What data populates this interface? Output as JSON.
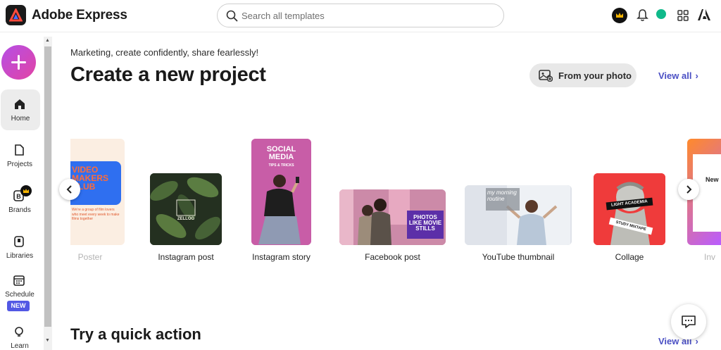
{
  "app": {
    "title": "Adobe Express"
  },
  "search": {
    "placeholder": "Search all templates"
  },
  "sidebar": {
    "items": [
      {
        "label": "Home",
        "icon": "home-icon",
        "active": true
      },
      {
        "label": "Projects",
        "icon": "projects-icon"
      },
      {
        "label": "Brands",
        "icon": "brands-icon"
      },
      {
        "label": "Libraries",
        "icon": "libraries-icon"
      },
      {
        "label": "Schedule",
        "icon": "schedule-icon",
        "badge": "NEW"
      },
      {
        "label": "Learn",
        "icon": "learn-icon"
      }
    ]
  },
  "main": {
    "tagline": "Marketing, create confidently, share fearlessly!",
    "heading": "Create a new project",
    "photo_button": "From your photo",
    "view_all": "View all",
    "cards": [
      {
        "label": "Poster"
      },
      {
        "label": "Instagram post"
      },
      {
        "label": "Instagram story"
      },
      {
        "label": "Facebook post"
      },
      {
        "label": "YouTube thumbnail"
      },
      {
        "label": "Collage"
      },
      {
        "label": "Inv"
      }
    ],
    "card_art": {
      "poster_title": "VIDEO MAKERS CLUB",
      "poster_body": "We're a group of film lovers who meet every week to make films together",
      "insta_post_word": "ZELLOG",
      "story_title": "SOCIAL MEDIA",
      "story_sub": "TIPS & TRICKS",
      "facebook_text": "PHOTOS LIKE MOVIE STILLS",
      "youtube_text": "my morning routine",
      "collage_top": "LIGHT ACADEMIA",
      "collage_bottom": "STUDY MIXTAPE",
      "invite_word": "New"
    },
    "quick_action_heading": "Try a quick action",
    "quick_view_all": "View all"
  },
  "colors": {
    "accent": "#4a4fc4",
    "create_gradient_start": "#b54fe6",
    "create_gradient_end": "#e243a4",
    "new_badge": "#5258e4",
    "status_dot": "#0fb98a"
  }
}
